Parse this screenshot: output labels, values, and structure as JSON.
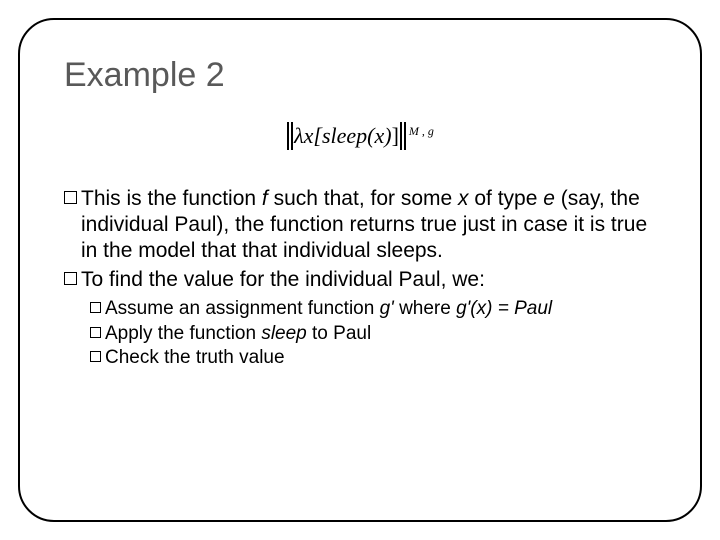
{
  "title": "Example 2",
  "formula": {
    "prefix": "λx[",
    "func": "sleep",
    "var": "(x)",
    "suffix": "]",
    "sup": "M , g"
  },
  "bullets": {
    "b1_a": "This is the function ",
    "b1_f": "f",
    "b1_b": " such that, for some ",
    "b1_x": "x",
    "b1_c": " of type ",
    "b1_e": "e",
    "b1_d": " (say, the individual Paul), the function returns true just in case it is true in the model that that individual sleeps.",
    "b2": "To find the value for the individual Paul, we:"
  },
  "sub": {
    "s1_a": "Assume an assignment function ",
    "s1_g": "g'",
    "s1_b": " where ",
    "s1_eq": "g'(x) = Paul",
    "s2_a": "Apply the function ",
    "s2_sleep": "sleep",
    "s2_b": " to Paul",
    "s3": "Check the truth value"
  }
}
